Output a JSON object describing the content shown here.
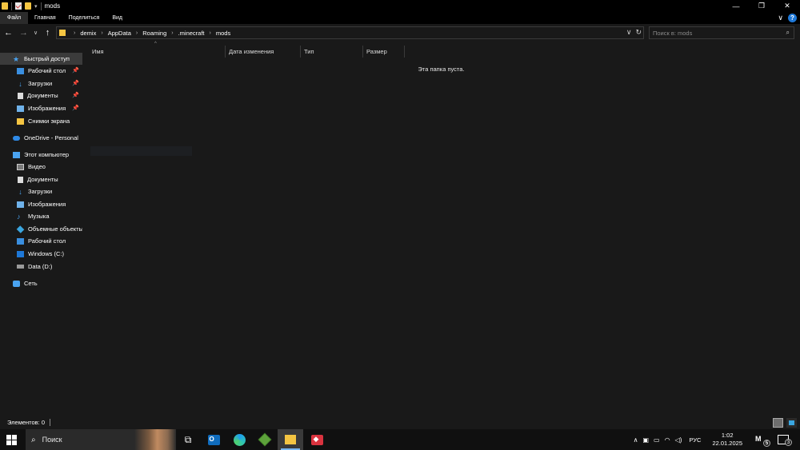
{
  "window": {
    "title": "mods",
    "minimize_label": "—",
    "maximize_label": "❐",
    "close_label": "✕"
  },
  "ribbon": {
    "tabs": [
      {
        "label": "Файл"
      },
      {
        "label": "Главная"
      },
      {
        "label": "Поделиться"
      },
      {
        "label": "Вид"
      }
    ]
  },
  "navigation": {
    "back": "←",
    "forward": "→",
    "recent": "∨",
    "up": "↑"
  },
  "address": {
    "breadcrumbs": [
      "demix",
      "AppData",
      "Roaming",
      ".minecraft",
      "mods"
    ],
    "separator": "›"
  },
  "search": {
    "placeholder": "Поиск в: mods",
    "icon": "search-icon"
  },
  "sidebar": {
    "items": [
      {
        "label": "Быстрый доступ",
        "icon": "star-icon"
      },
      {
        "label": "Рабочий стол",
        "icon": "desktop-icon",
        "pinned": true
      },
      {
        "label": "Загрузки",
        "icon": "download-icon",
        "pinned": true
      },
      {
        "label": "Документы",
        "icon": "document-icon",
        "pinned": true
      },
      {
        "label": "Изображения",
        "icon": "pictures-icon",
        "pinned": true
      },
      {
        "label": "Снимки экрана",
        "icon": "folder-icon"
      },
      {
        "label": "OneDrive - Personal",
        "icon": "cloud-icon"
      },
      {
        "label": "Этот компьютер",
        "icon": "computer-icon"
      },
      {
        "label": "Видео",
        "icon": "video-icon"
      },
      {
        "label": "Документы",
        "icon": "document-icon"
      },
      {
        "label": "Загрузки",
        "icon": "download-icon"
      },
      {
        "label": "Изображения",
        "icon": "pictures-icon"
      },
      {
        "label": "Музыка",
        "icon": "music-icon"
      },
      {
        "label": "Объемные объекты",
        "icon": "3d-objects-icon"
      },
      {
        "label": "Рабочий стол",
        "icon": "desktop-icon"
      },
      {
        "label": "Windows (C:)",
        "icon": "windows-drive-icon"
      },
      {
        "label": "Data (D:)",
        "icon": "drive-icon"
      },
      {
        "label": "Сеть",
        "icon": "network-icon"
      }
    ]
  },
  "columns": [
    {
      "label": "Имя"
    },
    {
      "label": "Дата изменения"
    },
    {
      "label": "Тип"
    },
    {
      "label": "Размер"
    }
  ],
  "empty_message": "Эта папка пуста.",
  "status": {
    "items_text": "Элементов: 0"
  },
  "taskbar": {
    "search_text": "Поиск",
    "apps": [
      "task-view",
      "outlook",
      "edge",
      "minecraft",
      "file-explorer",
      "red-app"
    ],
    "tray": {
      "language": "РУС",
      "time": "1:02",
      "date": "22.01.2025",
      "app_label": "M",
      "app_badge": "5",
      "notification_count": "3"
    }
  },
  "colors": {
    "background": "#191919",
    "accent": "#4aa3f0",
    "folder": "#f5c542"
  }
}
